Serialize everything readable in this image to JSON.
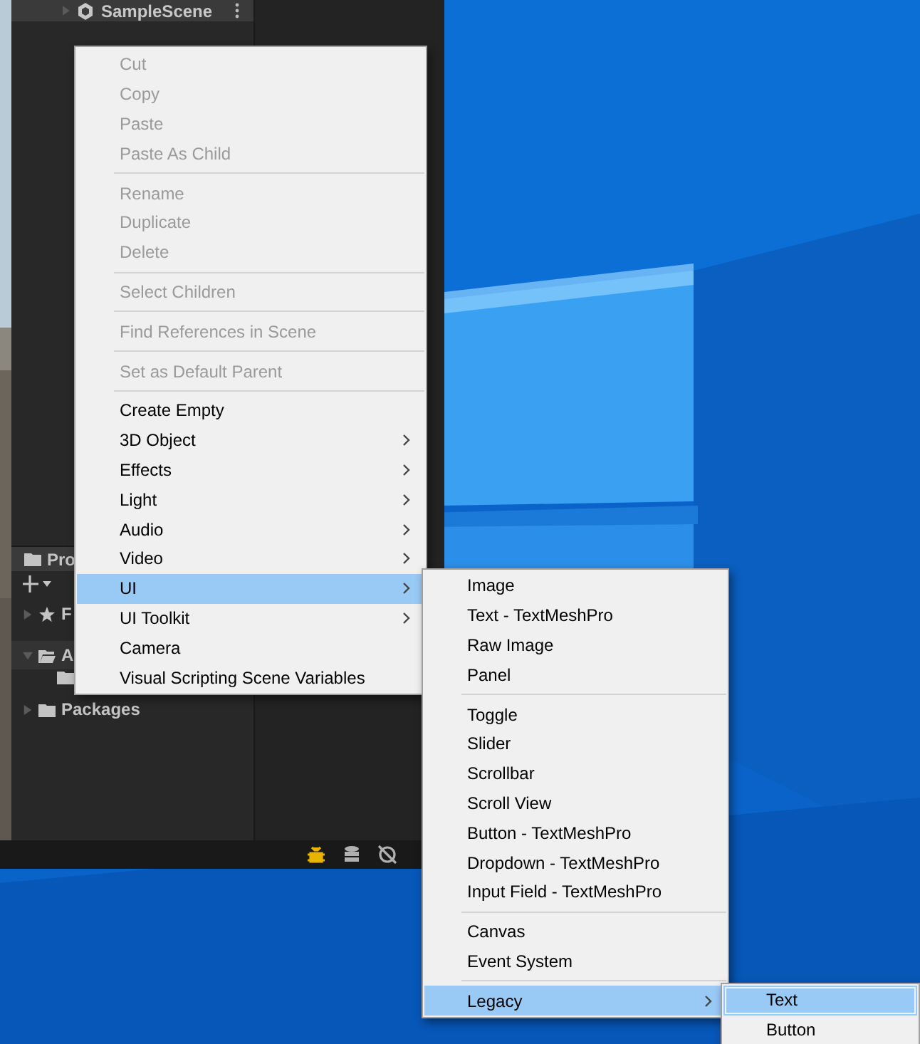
{
  "editor": {
    "hierarchy": {
      "scene": "SampleScene"
    },
    "project": {
      "tab": "Pro",
      "favorites": "F",
      "assets": "A",
      "packages": "Packages"
    }
  },
  "context_menu": {
    "items": [
      {
        "kind": "item",
        "label": "Cut",
        "disabled": true,
        "selected": false,
        "submenu": false
      },
      {
        "kind": "item",
        "label": "Copy",
        "disabled": true,
        "selected": false,
        "submenu": false
      },
      {
        "kind": "item",
        "label": "Paste",
        "disabled": true,
        "selected": false,
        "submenu": false
      },
      {
        "kind": "item",
        "label": "Paste As Child",
        "disabled": true,
        "selected": false,
        "submenu": false
      },
      {
        "kind": "separator"
      },
      {
        "kind": "item",
        "label": "Rename",
        "disabled": true,
        "selected": false,
        "submenu": false
      },
      {
        "kind": "item",
        "label": "Duplicate",
        "disabled": true,
        "selected": false,
        "submenu": false
      },
      {
        "kind": "item",
        "label": "Delete",
        "disabled": true,
        "selected": false,
        "submenu": false
      },
      {
        "kind": "separator"
      },
      {
        "kind": "item",
        "label": "Select Children",
        "disabled": true,
        "selected": false,
        "submenu": false
      },
      {
        "kind": "separator"
      },
      {
        "kind": "item",
        "label": "Find References in Scene",
        "disabled": true,
        "selected": false,
        "submenu": false
      },
      {
        "kind": "separator"
      },
      {
        "kind": "item",
        "label": "Set as Default Parent",
        "disabled": true,
        "selected": false,
        "submenu": false
      },
      {
        "kind": "separator"
      },
      {
        "kind": "item",
        "label": "Create Empty",
        "disabled": false,
        "selected": false,
        "submenu": false
      },
      {
        "kind": "item",
        "label": "3D Object",
        "disabled": false,
        "selected": false,
        "submenu": true
      },
      {
        "kind": "item",
        "label": "Effects",
        "disabled": false,
        "selected": false,
        "submenu": true
      },
      {
        "kind": "item",
        "label": "Light",
        "disabled": false,
        "selected": false,
        "submenu": true
      },
      {
        "kind": "item",
        "label": "Audio",
        "disabled": false,
        "selected": false,
        "submenu": true
      },
      {
        "kind": "item",
        "label": "Video",
        "disabled": false,
        "selected": false,
        "submenu": true
      },
      {
        "kind": "item",
        "label": "UI",
        "disabled": false,
        "selected": true,
        "submenu": true
      },
      {
        "kind": "item",
        "label": "UI Toolkit",
        "disabled": false,
        "selected": false,
        "submenu": true
      },
      {
        "kind": "item",
        "label": "Camera",
        "disabled": false,
        "selected": false,
        "submenu": false
      },
      {
        "kind": "item",
        "label": "Visual Scripting Scene Variables",
        "disabled": false,
        "selected": false,
        "submenu": false
      }
    ]
  },
  "ui_submenu": {
    "items": [
      {
        "kind": "item",
        "label": "Image",
        "disabled": false,
        "selected": false,
        "submenu": false
      },
      {
        "kind": "item",
        "label": "Text - TextMeshPro",
        "disabled": false,
        "selected": false,
        "submenu": false
      },
      {
        "kind": "item",
        "label": "Raw Image",
        "disabled": false,
        "selected": false,
        "submenu": false
      },
      {
        "kind": "item",
        "label": "Panel",
        "disabled": false,
        "selected": false,
        "submenu": false
      },
      {
        "kind": "separator"
      },
      {
        "kind": "item",
        "label": "Toggle",
        "disabled": false,
        "selected": false,
        "submenu": false
      },
      {
        "kind": "item",
        "label": "Slider",
        "disabled": false,
        "selected": false,
        "submenu": false
      },
      {
        "kind": "item",
        "label": "Scrollbar",
        "disabled": false,
        "selected": false,
        "submenu": false
      },
      {
        "kind": "item",
        "label": "Scroll View",
        "disabled": false,
        "selected": false,
        "submenu": false
      },
      {
        "kind": "item",
        "label": "Button - TextMeshPro",
        "disabled": false,
        "selected": false,
        "submenu": false
      },
      {
        "kind": "item",
        "label": "Dropdown - TextMeshPro",
        "disabled": false,
        "selected": false,
        "submenu": false
      },
      {
        "kind": "item",
        "label": "Input Field - TextMeshPro",
        "disabled": false,
        "selected": false,
        "submenu": false
      },
      {
        "kind": "separator"
      },
      {
        "kind": "item",
        "label": "Canvas",
        "disabled": false,
        "selected": false,
        "submenu": false
      },
      {
        "kind": "item",
        "label": "Event System",
        "disabled": false,
        "selected": false,
        "submenu": false
      },
      {
        "kind": "separator"
      },
      {
        "kind": "item",
        "label": "Legacy",
        "disabled": false,
        "selected": true,
        "submenu": true
      }
    ]
  },
  "legacy_submenu": {
    "items": [
      {
        "kind": "item",
        "label": "Text",
        "disabled": false,
        "selected": true,
        "submenu": false
      },
      {
        "kind": "item",
        "label": "Button",
        "disabled": false,
        "selected": false,
        "submenu": false
      }
    ]
  }
}
